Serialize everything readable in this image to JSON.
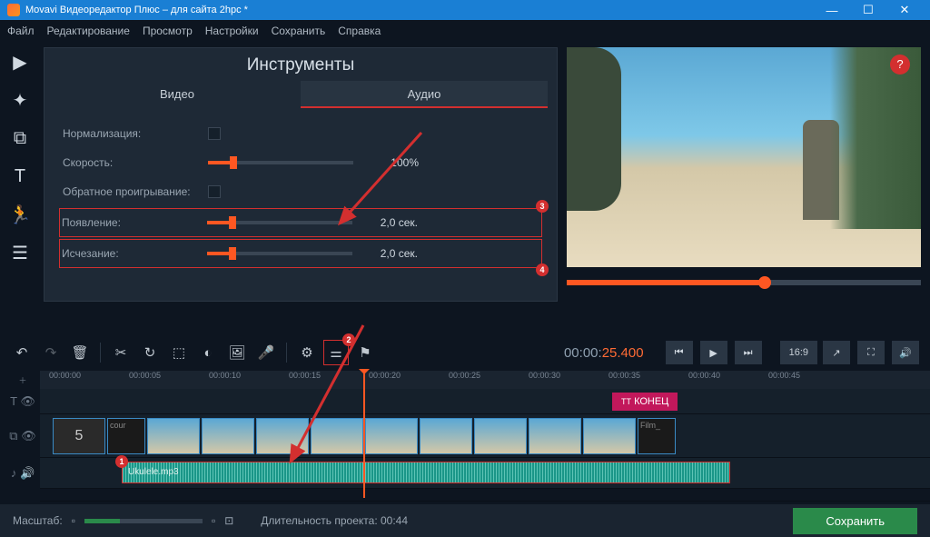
{
  "window": {
    "title": "Movavi Видеоредактор Плюс – для сайта 2hpc *"
  },
  "menu": [
    "Файл",
    "Редактирование",
    "Просмотр",
    "Настройки",
    "Сохранить",
    "Справка"
  ],
  "panel": {
    "title": "Инструменты",
    "tab_video": "Видео",
    "tab_audio": "Аудио",
    "normalize": "Нормализация:",
    "speed": "Скорость:",
    "speed_val": "100%",
    "reverse": "Обратное проигрывание:",
    "fadein": "Появление:",
    "fadein_val": "2,0 сек.",
    "fadeout": "Исчезание:",
    "fadeout_val": "2,0 сек."
  },
  "badges": {
    "b1": "1",
    "b2": "2",
    "b3": "3",
    "b4": "4"
  },
  "timecode": {
    "gray": "00:00:",
    "orange": "25.400"
  },
  "ratio": "16:9",
  "ruler": [
    "00:00:00",
    "00:00:05",
    "00:00:10",
    "00:00:15",
    "00:00:20",
    "00:00:25",
    "00:00:30",
    "00:00:35",
    "00:00:40",
    "00:00:45"
  ],
  "end_tag": "КОНЕЦ",
  "clips": {
    "c0": "5",
    "c1": "cour",
    "c11": "Film_"
  },
  "audio": {
    "name": "Ukulele.mp3"
  },
  "footer": {
    "zoom": "Масштаб:",
    "duration": "Длительность проекта:  00:44",
    "save": "Сохранить"
  },
  "help": "?"
}
